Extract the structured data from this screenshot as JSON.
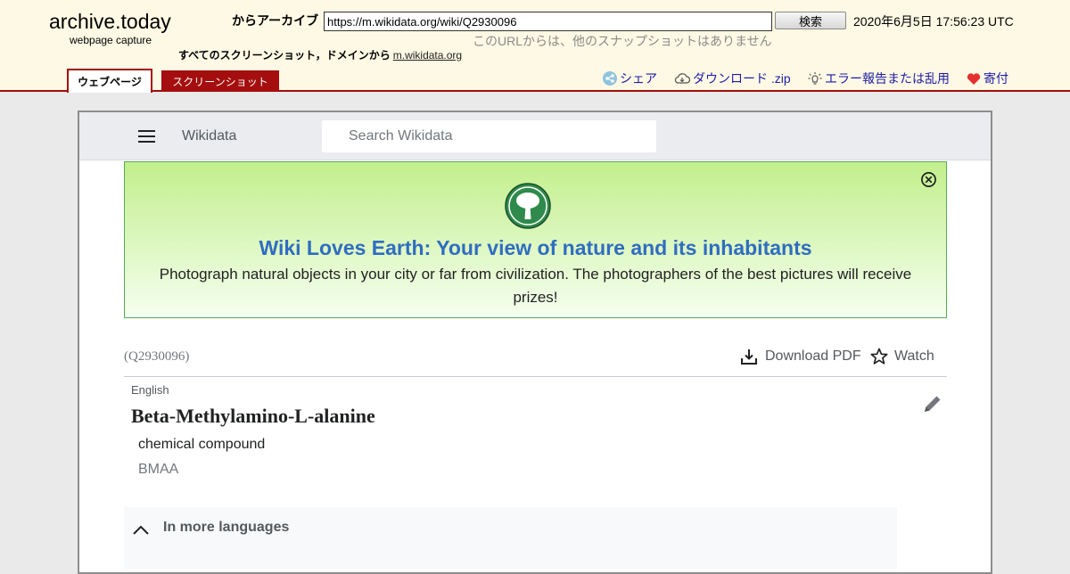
{
  "archive": {
    "logo": "archive.today",
    "logo_sub": "webpage capture",
    "archive_label": "からアーカイブ",
    "url_value": "https://m.wikidata.org/wiki/Q2930096",
    "search_button": "検索",
    "capture_time": "2020年6月5日 17:56:23 UTC",
    "no_snapshots": "このURLからは、他のスナップショットはありません",
    "all_screenshots_label": "すべてのスクリーンショット，ドメインから",
    "all_screenshots_domain": "m.wikidata.org",
    "tabs": {
      "webpage": "ウェブページ",
      "screenshot": "スクリーンショット"
    },
    "links": {
      "share": "シェア",
      "download": "ダウンロード .zip",
      "report": "エラー報告または乱用",
      "donate": "寄付"
    },
    "colors": {
      "header_bg": "#fef9e4",
      "accent": "#a40e0e",
      "link": "#1c1ca8"
    }
  },
  "page": {
    "site_name": "Wikidata",
    "search_placeholder": "Search Wikidata",
    "banner": {
      "title": "Wiki Loves Earth: Your view of nature and its inhabitants",
      "text": "Photograph natural objects in your city or far from civilization. The photographers of the best pictures will receive prizes!"
    },
    "entity": {
      "qid": "(Q2930096)",
      "download_pdf": "Download PDF",
      "watch": "Watch",
      "language": "English",
      "label": "Beta-Methylamino-L-alanine",
      "description": "chemical compound",
      "alias": "BMAA",
      "more_languages": "In more languages"
    }
  }
}
